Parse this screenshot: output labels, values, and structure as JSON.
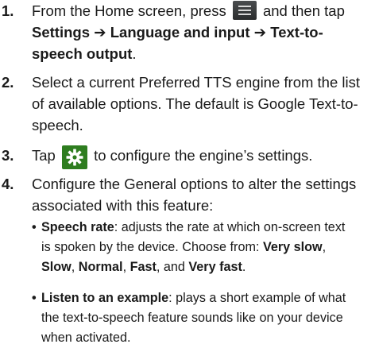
{
  "steps": [
    {
      "num": "1.",
      "t1": "From the Home screen, press",
      "t2": "and then tap",
      "t3": "Settings ➔ Language and input ➔ Text-to-speech output",
      "t4": "."
    },
    {
      "num": "2.",
      "text": "Select a current Preferred TTS engine from the list of available options. The default is Google Text-to-speech."
    },
    {
      "num": "3.",
      "t1": "Tap",
      "t2": "to configure the engine’s settings."
    },
    {
      "num": "4.",
      "text": "Configure the General options to alter the settings associated with this feature:"
    }
  ],
  "bullets": [
    {
      "term": "Speech rate",
      "d1": ": adjusts the rate at which on-screen text is spoken by the device. Choose from: ",
      "o1": "Very slow",
      "s1": ", ",
      "o2": "Slow",
      "s2": ", ",
      "o3": "Normal",
      "s3": ", ",
      "o4": "Fast",
      "s4": ", and ",
      "o5": "Very fast",
      "s5": "."
    },
    {
      "term": "Listen to an example",
      "d1": ": plays a short example of what the text-to-speech feature sounds like on your device when activated."
    }
  ],
  "colors": {
    "gear_icon_bg": "#2e7d1f",
    "menu_icon_bg": "#3a3c3e"
  },
  "icons": {
    "menu": "menu-icon",
    "gear": "gear-icon"
  }
}
